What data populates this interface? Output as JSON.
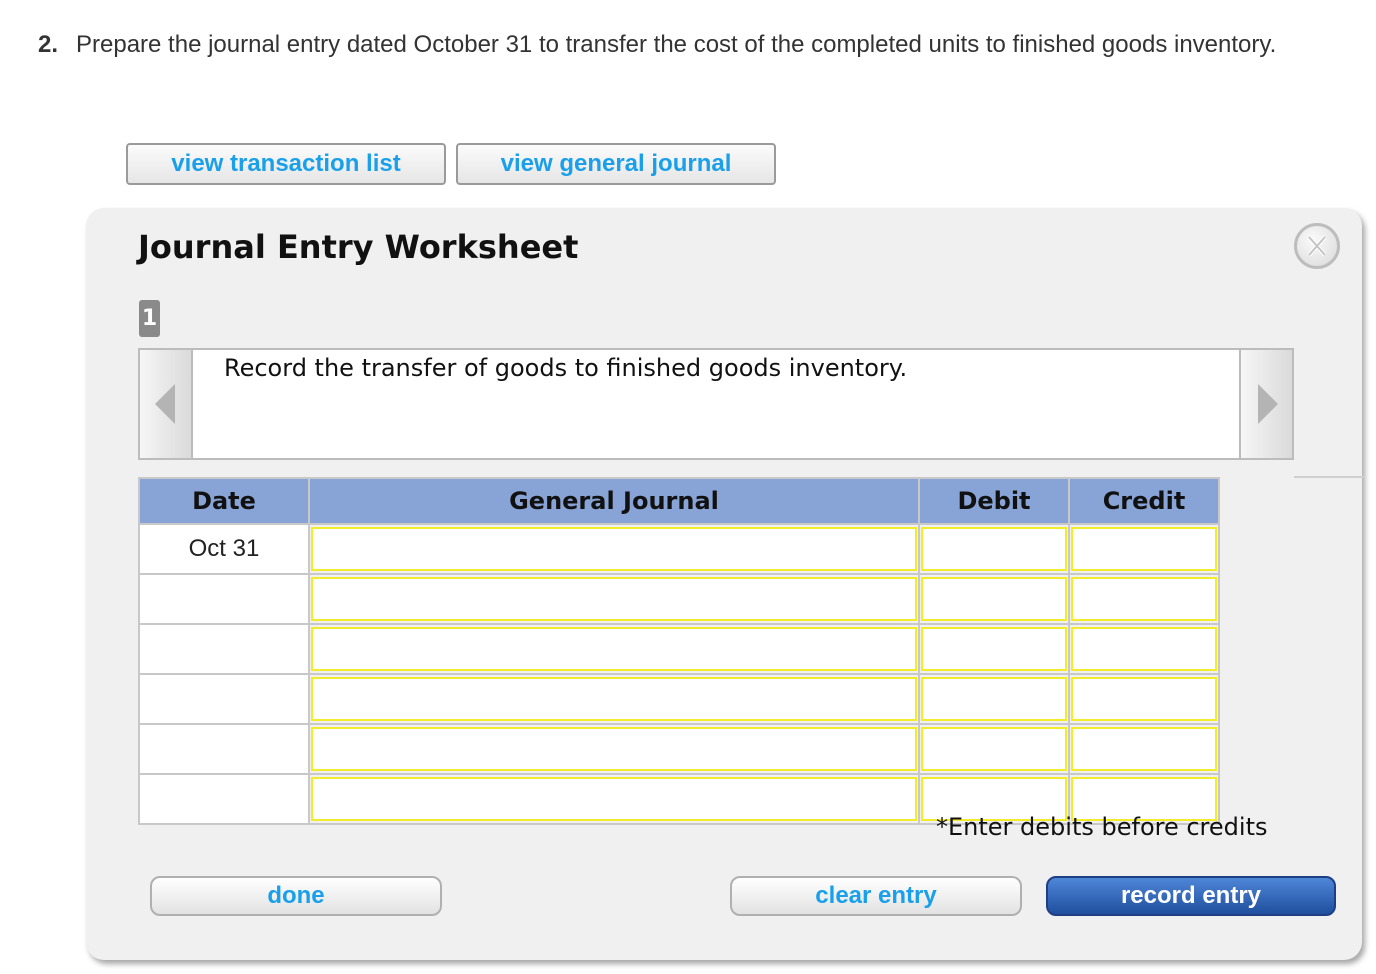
{
  "question": {
    "number": "2.",
    "text": "Prepare the journal entry dated October 31 to transfer the cost of the completed units to finished goods inventory."
  },
  "buttons": {
    "view_transaction_list": "view transaction list",
    "view_general_journal": "view general journal"
  },
  "worksheet": {
    "title": "Journal Entry Worksheet",
    "close_label": "X",
    "step": "1",
    "description": "Record the transfer of goods to finished goods inventory.",
    "table": {
      "headers": [
        "Date",
        "General Journal",
        "Debit",
        "Credit"
      ],
      "rows": [
        {
          "date": "Oct 31",
          "account": "",
          "debit": "",
          "credit": ""
        },
        {
          "date": "",
          "account": "",
          "debit": "",
          "credit": ""
        },
        {
          "date": "",
          "account": "",
          "debit": "",
          "credit": ""
        },
        {
          "date": "",
          "account": "",
          "debit": "",
          "credit": ""
        },
        {
          "date": "",
          "account": "",
          "debit": "",
          "credit": ""
        },
        {
          "date": "",
          "account": "",
          "debit": "",
          "credit": ""
        }
      ]
    },
    "note": "*Enter debits before credits",
    "done_label": "done",
    "clear_label": "clear entry",
    "record_label": "record entry"
  },
  "colors": {
    "link_blue": "#1aa0ea",
    "header_blue": "#88a4d6",
    "input_border_yellow": "#f2ec2b",
    "record_button": "#2a5db0"
  },
  "icons": {
    "close": "close-x-icon",
    "prev": "triangle-left-icon",
    "next": "triangle-right-icon"
  }
}
